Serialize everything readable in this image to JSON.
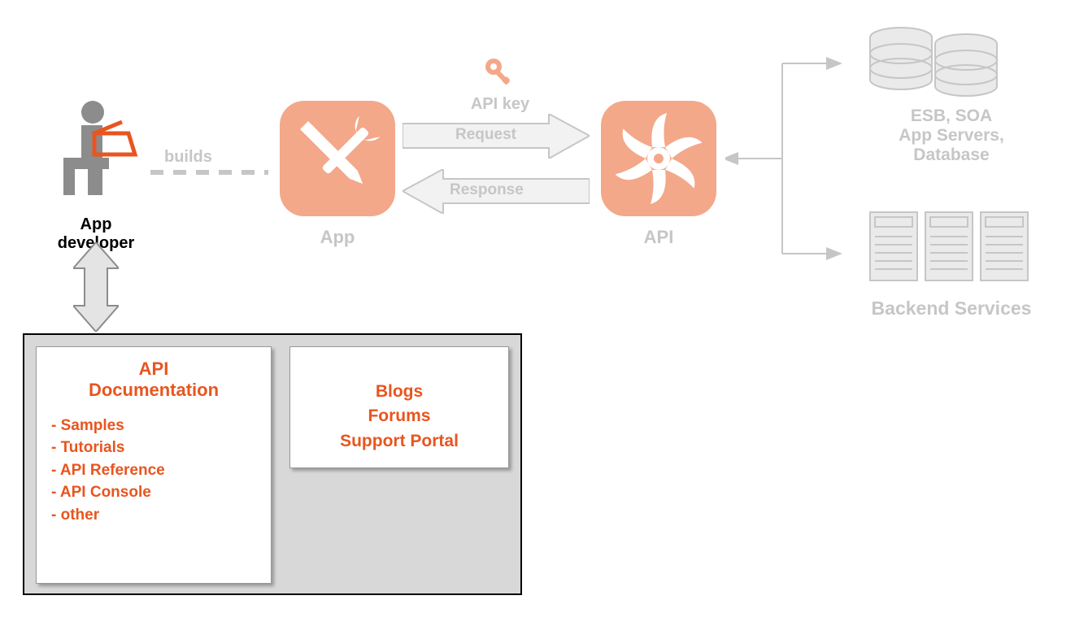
{
  "nodes": {
    "developer": {
      "label": "App developer"
    },
    "app": {
      "label": "App"
    },
    "api": {
      "label": "API"
    },
    "backend": {
      "label": "Backend Services",
      "servicesLine1": "ESB, SOA",
      "servicesLine2": "App Servers,",
      "servicesLine3": "Database"
    }
  },
  "edges": {
    "builds": "builds",
    "apiKey": "API key",
    "request": "Request",
    "response": "Response"
  },
  "portal": {
    "apiDoc": {
      "title": "API\nDocumentation",
      "items": [
        "- Samples",
        "- Tutorials",
        "- API Reference",
        "- API Console",
        "- other"
      ]
    },
    "support": {
      "items": [
        "Blogs",
        "Forums",
        "Support Portal"
      ]
    }
  },
  "colors": {
    "accent": "#e8551f",
    "faded": "#c6c6c6",
    "appIcon": "#f3a88a",
    "apiIcon": "#f3a88a"
  }
}
